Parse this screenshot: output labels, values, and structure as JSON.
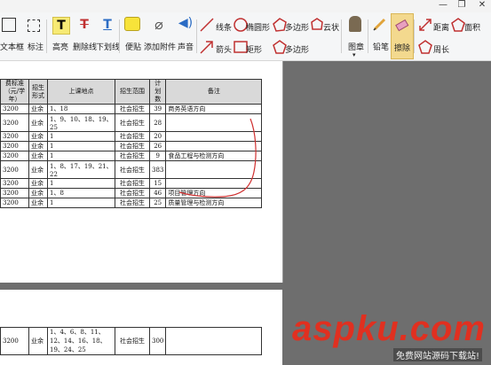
{
  "toolbar": {
    "textbox": "文本框",
    "note": "标注",
    "highlight": "高亮",
    "strikethrough": "删除线",
    "underline": "下划线",
    "sticky": "便贴",
    "attach": "添加附件",
    "sound": "声音",
    "line": "线条",
    "ellipse": "椭圆形",
    "polygon": "多边形",
    "cloud": "云状",
    "arrow": "箭头",
    "rect": "矩形",
    "polygon2": "多边形",
    "stamp": "图章",
    "pencil": "铅笔",
    "eraser": "擦除",
    "distance": "距离",
    "area": "面积",
    "perimeter": "周长"
  },
  "table": {
    "headers": [
      "费标准（元/学年）",
      "招生形式",
      "上课地点",
      "招生范围",
      "计划数",
      "备注"
    ],
    "rows": [
      [
        "3200",
        "业余",
        "1、18",
        "社会招生",
        "39",
        "商务英语方向"
      ],
      [
        "3200",
        "业余",
        "1、9、10、18、19、25",
        "社会招生",
        "28",
        ""
      ],
      [
        "3200",
        "业余",
        "1",
        "社会招生",
        "20",
        ""
      ],
      [
        "3200",
        "业余",
        "1",
        "社会招生",
        "26",
        ""
      ],
      [
        "3200",
        "业余",
        "1",
        "社会招生",
        "9",
        "食品工程与检测方向"
      ],
      [
        "3200",
        "业余",
        "1、8、17、19、21、22",
        "社会招生",
        "383",
        ""
      ],
      [
        "3200",
        "业余",
        "1",
        "社会招生",
        "15",
        ""
      ],
      [
        "3200",
        "业余",
        "1、8",
        "社会招生",
        "46",
        "项目管理方向"
      ],
      [
        "3200",
        "业余",
        "1",
        "社会招生",
        "25",
        "质量管理与检测方向"
      ]
    ]
  },
  "table2": {
    "rows": [
      [
        "3200",
        "业余",
        "1、4、6、8、11、12、14、16、18、19、24、25",
        "社会招生",
        "300",
        ""
      ]
    ]
  },
  "watermark": {
    "brand": "aspku.com",
    "sub": "免费网站源码下载站!"
  },
  "colors": {
    "annotation_red": "#d03030",
    "page_background": "#6e6e6e",
    "eraser_active": "#f3d98e"
  }
}
